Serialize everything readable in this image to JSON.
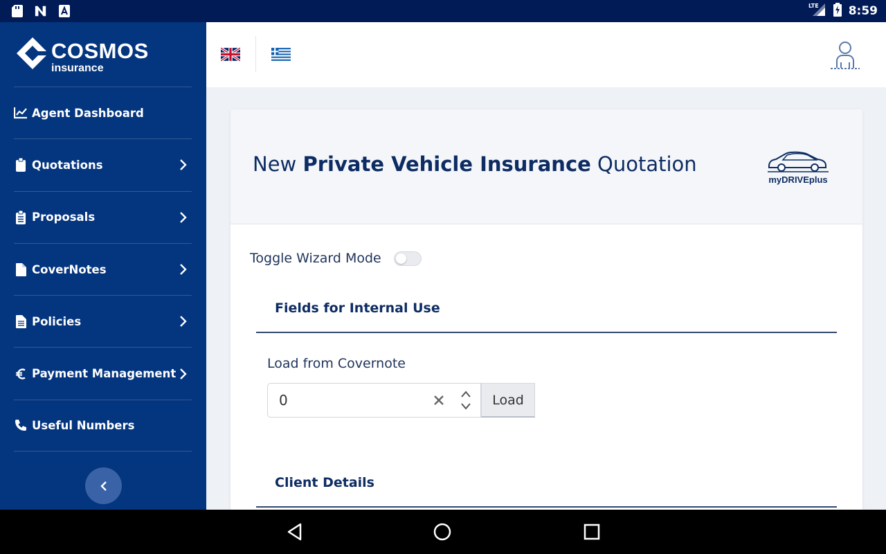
{
  "status_bar": {
    "time": "8:59",
    "network": "LTE",
    "left_icons": [
      "sd-card-icon",
      "n-notification-icon",
      "a-notification-icon"
    ]
  },
  "sidebar": {
    "brand": "COSMOS",
    "brand_sub": "insurance",
    "items": [
      {
        "label": "Agent Dashboard",
        "icon": "chart-line-icon",
        "has_chevron": false
      },
      {
        "label": "Quotations",
        "icon": "clipboard-icon",
        "has_chevron": true
      },
      {
        "label": "Proposals",
        "icon": "clipboard-list-icon",
        "has_chevron": true
      },
      {
        "label": "CoverNotes",
        "icon": "file-icon",
        "has_chevron": true
      },
      {
        "label": "Policies",
        "icon": "file-text-icon",
        "has_chevron": true
      },
      {
        "label": "Payment Management",
        "icon": "euro-icon",
        "has_chevron": true
      },
      {
        "label": "Useful Numbers",
        "icon": "phone-icon",
        "has_chevron": false
      }
    ]
  },
  "header": {
    "languages": [
      "English (UK flag)",
      "Greek (GR flag)"
    ]
  },
  "page": {
    "title_prefix": "New ",
    "title_bold": "Private Vehicle Insurance",
    "title_suffix": " Quotation",
    "product_name": "myDRIVEplus",
    "wizard_label": "Toggle Wizard Mode",
    "wizard_enabled": false,
    "sections": {
      "internal": "Fields for Internal Use",
      "client": "Client Details"
    },
    "load_field": {
      "label": "Load from Covernote",
      "value": "0",
      "button": "Load"
    }
  },
  "colors": {
    "sidebar_bg": "#04357f",
    "status_bar_bg": "#011b57",
    "title_color": "#0d2c63",
    "content_bg": "#eef1f6"
  }
}
